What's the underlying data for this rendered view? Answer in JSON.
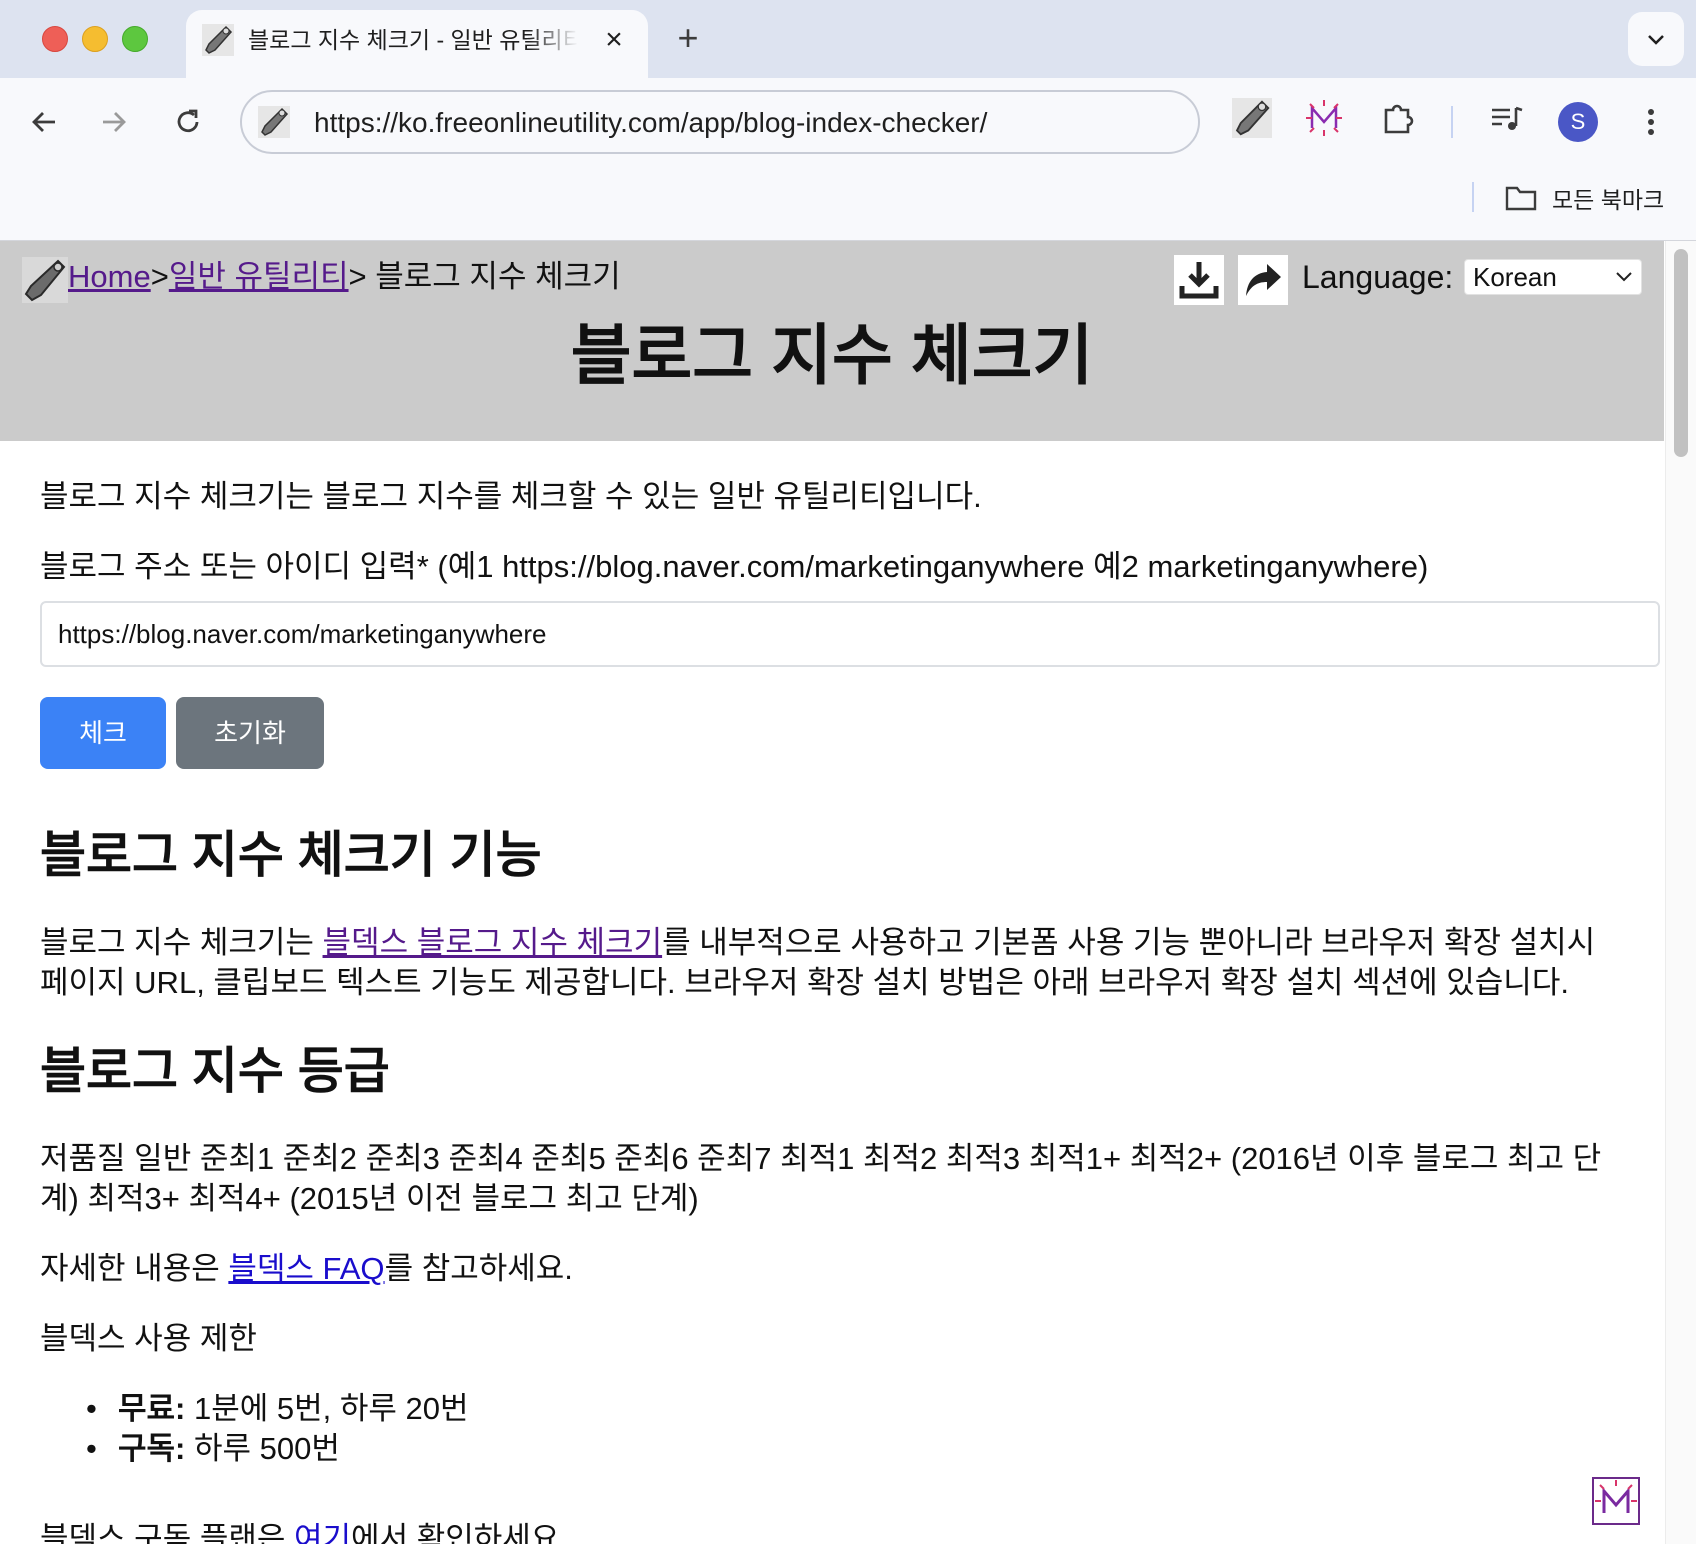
{
  "browser": {
    "tab_title": "블로그 지수 체크기 - 일반 유틸리티",
    "tab_close": "×",
    "new_tab": "+",
    "url": "https://ko.freeonlineutility.com/app/blog-index-checker/",
    "avatar_letter": "S",
    "bookmarks_all": "모든 북마크",
    "icons": [
      "back-arrow-icon",
      "forward-arrow-icon",
      "reload-icon",
      "wrench-icon",
      "extension-m-icon",
      "puzzle-icon",
      "media-controls-icon",
      "more-vert-icon",
      "folder-icon",
      "chevron-down-icon"
    ]
  },
  "header": {
    "breadcrumb_home": "Home",
    "breadcrumb_sep": ">",
    "breadcrumb_category": "일반 유틸리티",
    "breadcrumb_current": "> 블로그 지수 체크기",
    "language_label": "Language:",
    "language_value": "Korean",
    "title": "블로그 지수 체크기",
    "icons": [
      "download-icon",
      "share-icon"
    ]
  },
  "main": {
    "intro": "블로그 지수 체크기는 블로그 지수를 체크할 수 있는 일반 유틸리티입니다.",
    "input_label": "블로그 주소 또는 아이디 입력* (예1 https://blog.naver.com/marketinganywhere 예2 marketinganywhere)",
    "input_value": "https://blog.naver.com/marketinganywhere",
    "check_button": "체크",
    "reset_button": "초기화",
    "features_heading": "블로그 지수 체크기 기능",
    "features_pre": "블로그 지수 체크기는 ",
    "features_link": "블덱스 블로그 지수 체크기",
    "features_post": "를 내부적으로 사용하고 기본폼 사용 기능 뿐아니라 브라우저 확장 설치시 페이지 URL, 클립보드 텍스트 기능도 제공합니다. 브라우저 확장 설치 방법은 아래 브라우저 확장 설치 섹션에 있습니다.",
    "grade_heading": "블로그 지수 등급",
    "grade_text": "저품질 일반 준최1 준최2 준최3 준최4 준최5 준최6 준최7 최적1 최적2 최적3 최적1+ 최적2+ (2016년 이후 블로그 최고 단계) 최적3+ 최적4+ (2015년 이전 블로그 최고 단계)",
    "faq_pre": "자세한 내용은 ",
    "faq_link": "블덱스 FAQ",
    "faq_post": "를 참고하세요.",
    "limits_label": "블덱스 사용 제한",
    "limits": [
      {
        "label": "무료:",
        "value": " 1분에 5번, 하루 20번"
      },
      {
        "label": "구독:",
        "value": " 하루 500번"
      }
    ],
    "plan_pre": "블덱스 구독 플랜은 ",
    "plan_link": "여기",
    "plan_post": "에서 확인하세요."
  }
}
